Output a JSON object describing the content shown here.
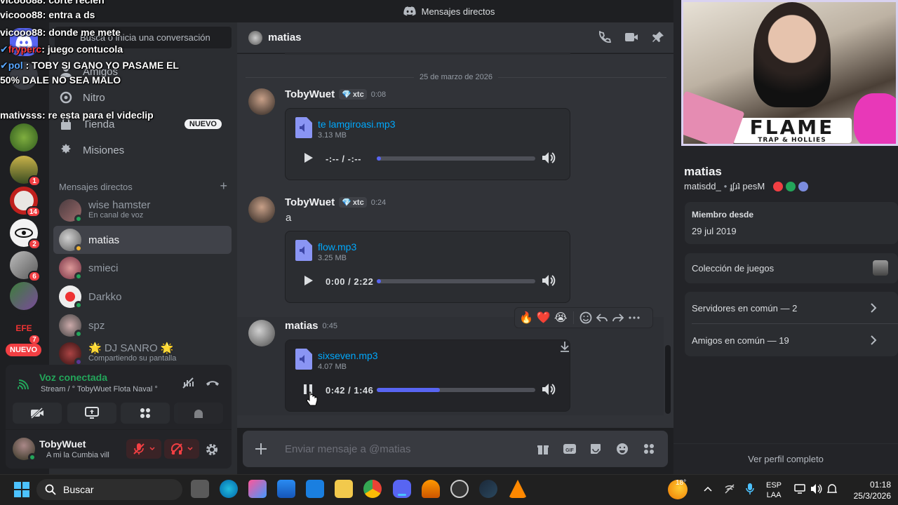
{
  "window": {
    "title": "Mensajes directos"
  },
  "sidebar": {
    "search_placeholder": "Busca o inicia una conversación",
    "nav": [
      {
        "label": "Amigos"
      },
      {
        "label": "Nitro"
      },
      {
        "label": "Tienda",
        "badge": "NUEVO"
      },
      {
        "label": "Misiones"
      }
    ],
    "dm_header": "Mensajes directos",
    "dms": [
      {
        "name": "wise hamster",
        "sub": "En canal de voz"
      },
      {
        "name": "matias",
        "sub": ""
      },
      {
        "name": "smieci",
        "sub": ""
      },
      {
        "name": "Darkko",
        "sub": ""
      },
      {
        "name": "spz",
        "sub": ""
      },
      {
        "name": "🌟 DJ SANRO 🌟",
        "sub": "Compartiendo su pantalla"
      }
    ],
    "servers_badges": [
      "1",
      "14",
      "2",
      "6",
      "7"
    ],
    "new_badge": "NUEVO",
    "voice": {
      "status": "Voz conectada",
      "channel": "Stream / ° TobyWuet Flota Naval °"
    },
    "user": {
      "name": "TobyWuet",
      "status": "A mi la Cumbia vill"
    }
  },
  "chat": {
    "header_name": "matias",
    "date_divider": "25 de marzo de 2026",
    "messages": [
      {
        "author": "TobyWuet",
        "tag": "xtc",
        "time": "0:08",
        "text": "",
        "file": {
          "name": "te lamgiroasi.mp3",
          "size": "3.13 MB",
          "time": "-:-- / -:--",
          "progress": 0.0
        }
      },
      {
        "author": "TobyWuet",
        "tag": "xtc",
        "time": "0:24",
        "text": "a",
        "file": {
          "name": "flow.mp3",
          "size": "3.25 MB",
          "time": "0:00 / 2:22",
          "progress": 0.0
        }
      },
      {
        "author": "matias",
        "tag": "",
        "time": "0:45",
        "text": "",
        "file": {
          "name": "sixseven.mp3",
          "size": "4.07 MB",
          "time": "0:42 / 1:46",
          "progress": 0.4
        }
      }
    ],
    "reactions": [
      "🔥",
      "❤️",
      "😭"
    ],
    "input_placeholder": "Enviar mensaje a @matias"
  },
  "profile": {
    "display_name": "matias",
    "username": "matisdd_",
    "pronoun_text": "ɟʃɹʇ pesM",
    "member_since_label": "Miembro desde",
    "member_since": "29 jul 2019",
    "games_label": "Colección de juegos",
    "servers_common": "Servidores en común — 2",
    "friends_common": "Amigos en común — 19",
    "view_full": "Ver perfil completo"
  },
  "webcam": {
    "banner": "FLAME",
    "banner_sub": "TRAP & HOLLIES"
  },
  "chat_overlay": [
    {
      "user": "vicooo88",
      "text": "corte recien"
    },
    {
      "user": "vicooo88",
      "text": "entra a ds"
    },
    {
      "user": "vicooo88",
      "text": "donde me mete"
    },
    {
      "user": "fryperc",
      "text": "juego contucola"
    },
    {
      "user": "pol",
      "text": "TOBY SI GANO YO PASAME EL"
    },
    {
      "user": "",
      "text": "50% DALE NO SEA MALO"
    },
    {
      "user": "mativsss",
      "text": "re esta para el videclip"
    }
  ],
  "taskbar": {
    "search": "Buscar",
    "temp": "18°",
    "lang1": "ESP",
    "lang2": "LAA",
    "time": "01:18",
    "date": "25/3/2026"
  },
  "colors": {
    "accent": "#5865f2",
    "link": "#00a8fc",
    "online": "#23a55a",
    "danger": "#f23f43"
  }
}
